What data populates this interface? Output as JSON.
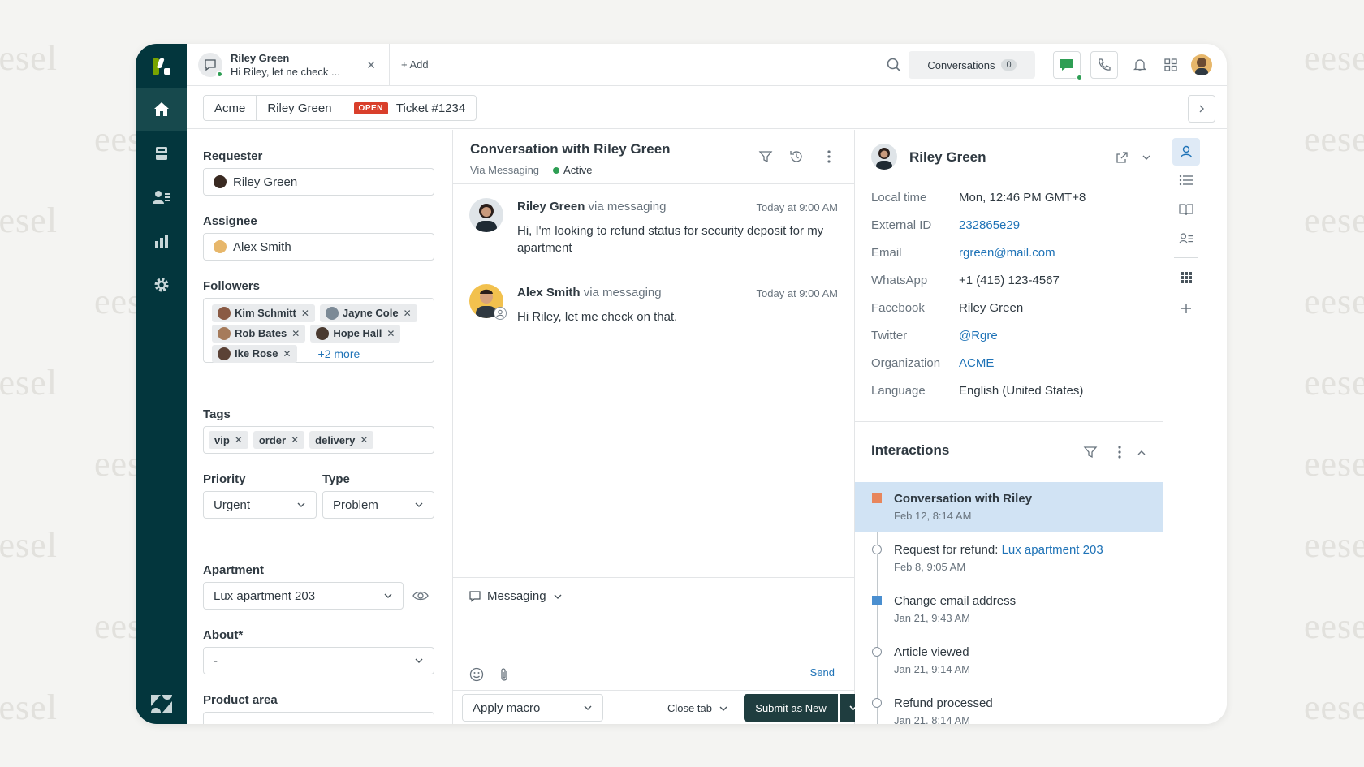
{
  "watermark": "eesel",
  "tabs": {
    "active": {
      "name": "Riley Green",
      "preview": "Hi Riley, let ne check ..."
    },
    "add_label": "Add"
  },
  "topbar": {
    "conversations_label": "Conversations",
    "conversations_count": "0"
  },
  "breadcrumb": {
    "org": "Acme",
    "requester": "Riley Green",
    "status": "OPEN",
    "ticket": "Ticket #1234"
  },
  "properties": {
    "requester_label": "Requester",
    "requester_value": "Riley Green",
    "assignee_label": "Assignee",
    "assignee_value": "Alex Smith",
    "followers_label": "Followers",
    "followers": [
      "Kim Schmitt",
      "Jayne Cole",
      "Rob Bates",
      "Hope Hall",
      "Ike Rose"
    ],
    "followers_more": "+2 more",
    "tags_label": "Tags",
    "tags": [
      "vip",
      "order",
      "delivery"
    ],
    "priority_label": "Priority",
    "priority_value": "Urgent",
    "type_label": "Type",
    "type_value": "Problem",
    "apartment_label": "Apartment",
    "apartment_value": "Lux apartment 203",
    "about_label": "About*",
    "about_value": "-",
    "product_area_label": "Product area"
  },
  "conversation": {
    "title": "Conversation with Riley Green",
    "via": "Via Messaging",
    "status": "Active",
    "messages": [
      {
        "author": "Riley Green",
        "via": "via messaging",
        "time": "Today at 9:00 AM",
        "text": "Hi, I'm looking to refund status for security deposit for my apartment"
      },
      {
        "author": "Alex Smith",
        "via": "via messaging",
        "time": "Today at 9:00 AM",
        "text": "Hi Riley, let me check on that."
      }
    ],
    "channel": "Messaging",
    "send_label": "Send"
  },
  "footer": {
    "macro": "Apply macro",
    "close_tab": "Close tab",
    "submit": "Submit as New"
  },
  "customer": {
    "name": "Riley Green",
    "fields": [
      {
        "key": "Local time",
        "value": "Mon, 12:46 PM GMT+8",
        "link": false
      },
      {
        "key": "External ID",
        "value": "232865e29",
        "link": true
      },
      {
        "key": "Email",
        "value": "rgreen@mail.com",
        "link": true
      },
      {
        "key": "WhatsApp",
        "value": "+1 (415) 123-4567",
        "link": false
      },
      {
        "key": "Facebook",
        "value": "Riley Green",
        "link": false
      },
      {
        "key": "Twitter",
        "value": "@Rgre",
        "link": true
      },
      {
        "key": "Organization",
        "value": "ACME",
        "link": true
      },
      {
        "key": "Language",
        "value": "English (United States)",
        "link": false
      }
    ]
  },
  "interactions": {
    "title": "Interactions",
    "items": [
      {
        "title": "Conversation with Riley",
        "link_text": "",
        "date": "Feb 12, 8:14 AM",
        "marker": "square-orange",
        "selected": true
      },
      {
        "title": "Request for refund: ",
        "link_text": "Lux apartment 203",
        "date": "Feb 8, 9:05 AM",
        "marker": "circle",
        "selected": false
      },
      {
        "title": "Change email address",
        "link_text": "",
        "date": "Jan 21, 9:43 AM",
        "marker": "square-blue",
        "selected": false
      },
      {
        "title": "Article viewed",
        "link_text": "",
        "date": "Jan 21, 9:14 AM",
        "marker": "circle",
        "selected": false
      },
      {
        "title": "Refund processed",
        "link_text": "",
        "date": "Jan 21, 8:14 AM",
        "marker": "circle",
        "selected": false
      }
    ]
  },
  "colors": {
    "rail": "#03363d",
    "accent_link": "#1f73b7",
    "status_open": "#d93f2b",
    "active_green": "#2e9e54",
    "submit": "#1f3d3f",
    "selected_row": "#d1e3f4"
  }
}
